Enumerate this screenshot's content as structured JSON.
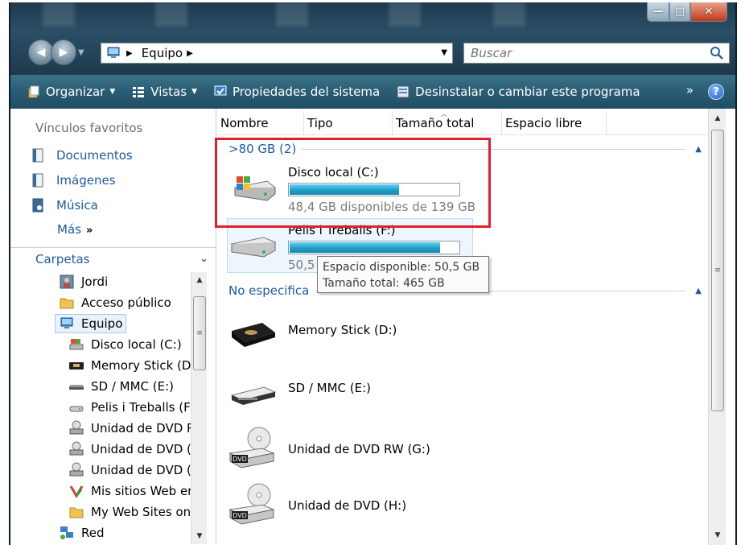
{
  "window": {
    "min_glyph": "—",
    "max_glyph": "□",
    "close_glyph": "✕"
  },
  "nav": {
    "back_glyph": "◀",
    "forward_glyph": "▶",
    "dropdown_glyph": "▼"
  },
  "address": {
    "crumb_sep": "▶",
    "location": "Equipo",
    "trail_sep": "▶",
    "drop_glyph": "▼",
    "refresh_glyph": "↻"
  },
  "search": {
    "placeholder": "Buscar"
  },
  "toolbar": {
    "organizar": "Organizar",
    "vistas": "Vistas",
    "propiedades": "Propiedades del sistema",
    "desinstalar": "Desinstalar o cambiar este programa",
    "more": "»",
    "help": "?",
    "caret": "▼"
  },
  "sidebar": {
    "favorites_title": "Vínculos favoritos",
    "favorites": [
      {
        "label": "Documentos",
        "icon": "documents-icon"
      },
      {
        "label": "Imágenes",
        "icon": "pictures-icon"
      },
      {
        "label": "Música",
        "icon": "music-icon"
      }
    ],
    "more_label": "Más",
    "more_glyph": "»",
    "folders_title": "Carpetas",
    "folders_chevron": "⌄",
    "tree": [
      {
        "label": "Jordi"
      },
      {
        "label": "Acceso público"
      },
      {
        "label": "Equipo"
      },
      {
        "label": "Disco local (C:)"
      },
      {
        "label": "Memory Stick (D:"
      },
      {
        "label": "SD / MMC (E:)"
      },
      {
        "label": "Pelis i Treballs (F:"
      },
      {
        "label": "Unidad de DVD R"
      },
      {
        "label": "Unidad de DVD (I"
      },
      {
        "label": "Unidad de DVD (I"
      },
      {
        "label": "Mis sitios Web er"
      },
      {
        "label": "My Web Sites on"
      },
      {
        "label": "Red"
      }
    ]
  },
  "columns": [
    "Nombre",
    "Tipo",
    "Tamaño total",
    "Espacio libre"
  ],
  "groups": {
    "hdd": {
      "label": ">80 GB (2)",
      "toggle": "▲"
    },
    "other": {
      "label": "No especifica",
      "toggle": "▲"
    }
  },
  "drives": {
    "c": {
      "name": "Disco local (C:)",
      "sub": "48,4 GB disponibles de 139 GB",
      "used_fraction": 0.652
    },
    "f": {
      "name": "Pelis i Treballs (F:)",
      "sub": "50,5",
      "used_fraction": 0.891
    },
    "d": {
      "name": "Memory Stick (D:)"
    },
    "e": {
      "name": "SD / MMC (E:)"
    },
    "g": {
      "name": "Unidad de DVD RW (G:)"
    },
    "h": {
      "name": "Unidad de DVD (H:)"
    }
  },
  "tooltip": {
    "line1": "Espacio disponible: 50,5 GB",
    "line2": "Tamaño total: 465 GB"
  },
  "scroll": {
    "up": "▲",
    "down": "▼",
    "grip": "≡"
  },
  "colors": {
    "accent": "#1e5a9c",
    "highlight": "#e0202a",
    "bar": "#1e9ec8"
  }
}
